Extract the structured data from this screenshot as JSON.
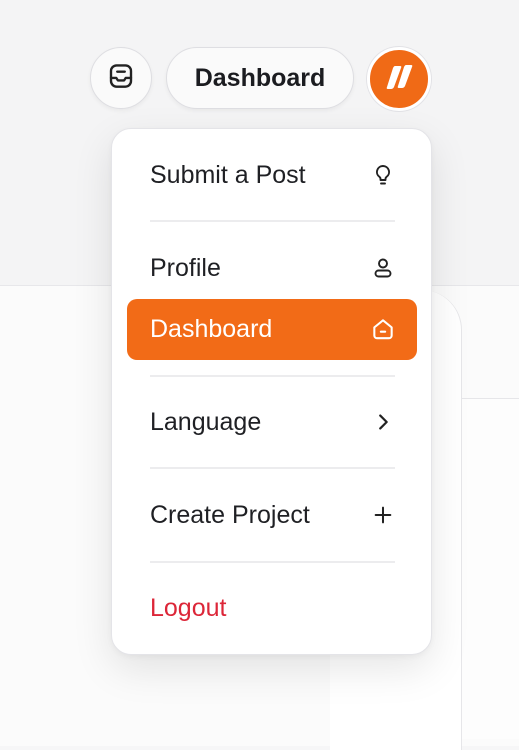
{
  "header": {
    "dashboard_label": "Dashboard",
    "inbox_icon": "inbox-icon",
    "avatar_icon": "brand-logo-icon"
  },
  "menu": {
    "items": [
      {
        "label": "Submit a Post",
        "icon": "lightbulb-icon"
      },
      {
        "label": "Profile",
        "icon": "user-icon"
      },
      {
        "label": "Dashboard",
        "icon": "home-icon",
        "active": true
      },
      {
        "label": "Language",
        "icon": "chevron-right-icon"
      },
      {
        "label": "Create Project",
        "icon": "plus-icon"
      },
      {
        "label": "Logout",
        "icon": ""
      }
    ]
  },
  "colors": {
    "accent": "#f26b17",
    "logout": "#dc2638",
    "text": "#1f2024"
  }
}
